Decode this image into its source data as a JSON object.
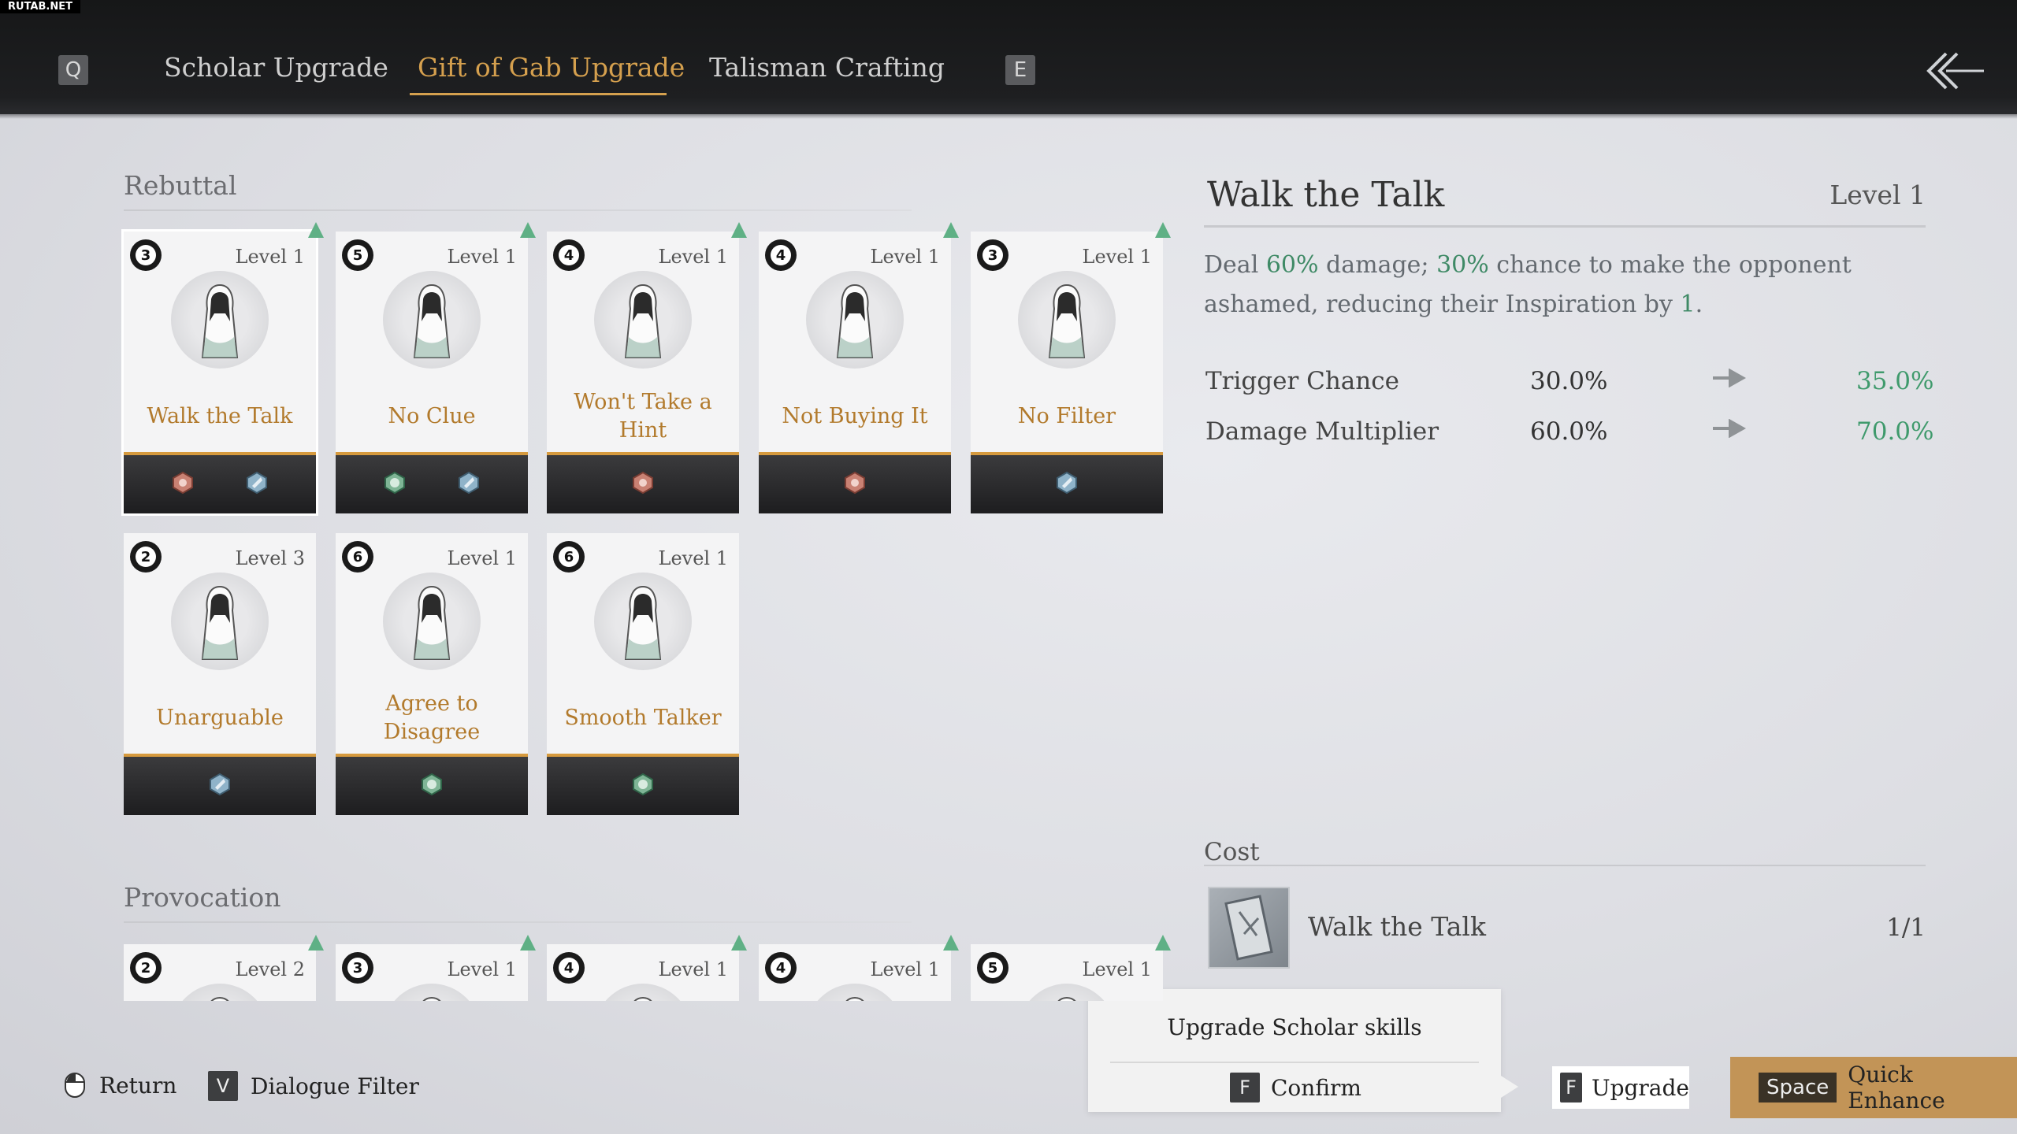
{
  "watermark": "RUTAB.NET",
  "nav": {
    "prev_key": "Q",
    "next_key": "E",
    "tabs": [
      {
        "label": "Scholar Upgrade",
        "active": false
      },
      {
        "label": "Gift of Gab Upgrade",
        "active": true
      },
      {
        "label": "Talisman Crafting",
        "active": false
      }
    ],
    "back_icon": "back-arrow-icon"
  },
  "sections": {
    "rebuttal": {
      "title": "Rebuttal",
      "cards": [
        {
          "name": "Walk the Talk",
          "level": "Level 1",
          "cost": "3",
          "selected": true,
          "gems": [
            "red-gem-icon",
            "blue-gem-icon"
          ],
          "upgradable": true
        },
        {
          "name": "No Clue",
          "level": "Level 1",
          "cost": "5",
          "selected": false,
          "gems": [
            "green-gem-icon",
            "blue-gem-icon"
          ],
          "upgradable": true
        },
        {
          "name": "Won't Take a Hint",
          "level": "Level 1",
          "cost": "4",
          "selected": false,
          "gems": [
            "red-gem-icon"
          ],
          "upgradable": true
        },
        {
          "name": "Not Buying It",
          "level": "Level 1",
          "cost": "4",
          "selected": false,
          "gems": [
            "red-gem-icon"
          ],
          "upgradable": true
        },
        {
          "name": "No Filter",
          "level": "Level 1",
          "cost": "3",
          "selected": false,
          "gems": [
            "blue-gem-icon"
          ],
          "upgradable": true
        },
        {
          "name": "Unarguable",
          "level": "Level 3",
          "cost": "2",
          "selected": false,
          "gems": [
            "blue-gem-icon"
          ],
          "upgradable": false
        },
        {
          "name": "Agree to Disagree",
          "level": "Level 1",
          "cost": "6",
          "selected": false,
          "gems": [
            "green-gem-icon"
          ],
          "upgradable": false
        },
        {
          "name": "Smooth Talker",
          "level": "Level 1",
          "cost": "6",
          "selected": false,
          "gems": [
            "green-gem-icon"
          ],
          "upgradable": false
        }
      ]
    },
    "provocation": {
      "title": "Provocation",
      "cards": [
        {
          "level": "Level 2",
          "cost": "2"
        },
        {
          "level": "Level 1",
          "cost": "3"
        },
        {
          "level": "Level 1",
          "cost": "4"
        },
        {
          "level": "Level 1",
          "cost": "4"
        },
        {
          "level": "Level 1",
          "cost": "5"
        }
      ]
    }
  },
  "detail": {
    "title": "Walk the Talk",
    "level": "Level 1",
    "desc": {
      "p1": "Deal ",
      "v1": "60%",
      "p2": " damage; ",
      "v2": "30%",
      "p3": " chance to make the opponent ashamed, reducing their Inspiration by ",
      "v3": "1",
      "p4": "."
    },
    "stats": [
      {
        "label": "Trigger Chance",
        "current": "30.0%",
        "next": "35.0%"
      },
      {
        "label": "Damage Multiplier",
        "current": "60.0%",
        "next": "70.0%"
      }
    ],
    "cost_label": "Cost",
    "cost_item": {
      "name": "Walk the Talk",
      "qty": "1/1"
    }
  },
  "popup": {
    "text": "Upgrade Scholar skills",
    "confirm_key": "F",
    "confirm_label": "Confirm"
  },
  "footer": {
    "return_label": "Return",
    "filter_key": "V",
    "filter_label": "Dialogue Filter",
    "upgrade_key": "F",
    "upgrade_label": "Upgrade",
    "quick_key": "Space",
    "quick_label": "Quick Enhance"
  },
  "colors": {
    "accent": "#d5a04e",
    "positive": "#3f9a6c",
    "card_name": "#b27a2c"
  }
}
